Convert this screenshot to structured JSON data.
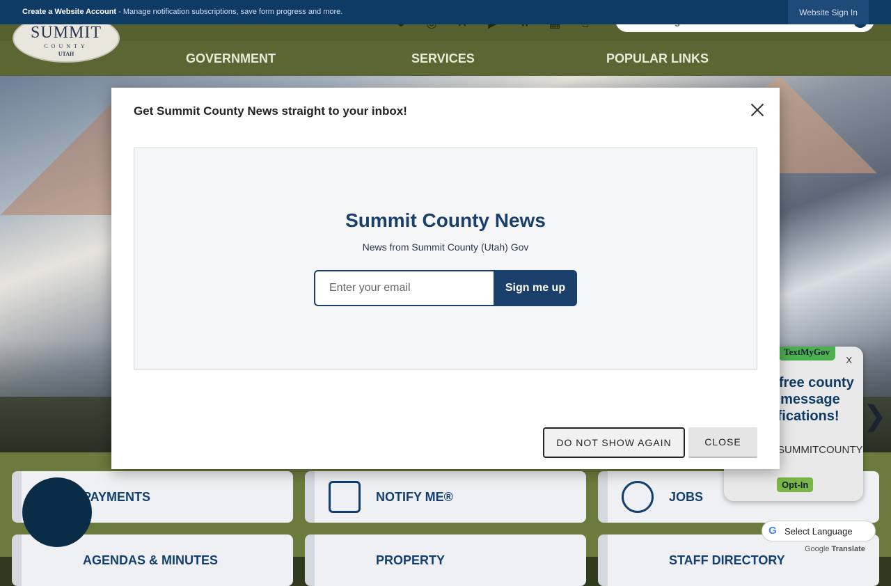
{
  "topbar": {
    "create_account": "Create a Website Account",
    "create_account_desc": " - Manage notification subscriptions, save form progress and more.",
    "sign_in": "Website Sign In"
  },
  "logo": {
    "line1": "SUMMIT",
    "line2": "COUNTY",
    "line3": "UTAH"
  },
  "search": {
    "placeholder": "I'm looking for..."
  },
  "social_icons": [
    "facebook-icon",
    "instagram-icon",
    "x-icon",
    "youtube-icon",
    "flickr-icon",
    "linkedin-icon",
    "nextdoor-icon"
  ],
  "nav": {
    "items": [
      "GOVERNMENT",
      "SERVICES",
      "POPULAR LINKS"
    ]
  },
  "quick_links": [
    "PAYMENTS",
    "NOTIFY ME®",
    "JOBS",
    "AGENDAS & MINUTES",
    "PROPERTY",
    "STAFF DIRECTORY"
  ],
  "textmygov": {
    "badge": "TextMyGov",
    "close": "X",
    "headline": "Get free county text message notifications!",
    "instruction": "Text \"SUMMITCOUNTY\" to",
    "opt_in": "Opt-In"
  },
  "translate": {
    "label": "Select Language",
    "powered_prefix": "Google",
    "powered": "Translate"
  },
  "modal": {
    "title": "Get Summit County News straight to your inbox!",
    "signup_title": "Summit County News",
    "signup_subtitle": "News from Summit County (Utah) Gov",
    "email_placeholder": "Enter your email",
    "signup_button": "Sign me up",
    "do_not_show": "DO NOT SHOW AGAIN",
    "close": "CLOSE"
  },
  "colors": {
    "brand_navy": "#0e3a66",
    "header_olive": "#5b6633",
    "signup_blue": "#1b3f6b"
  }
}
